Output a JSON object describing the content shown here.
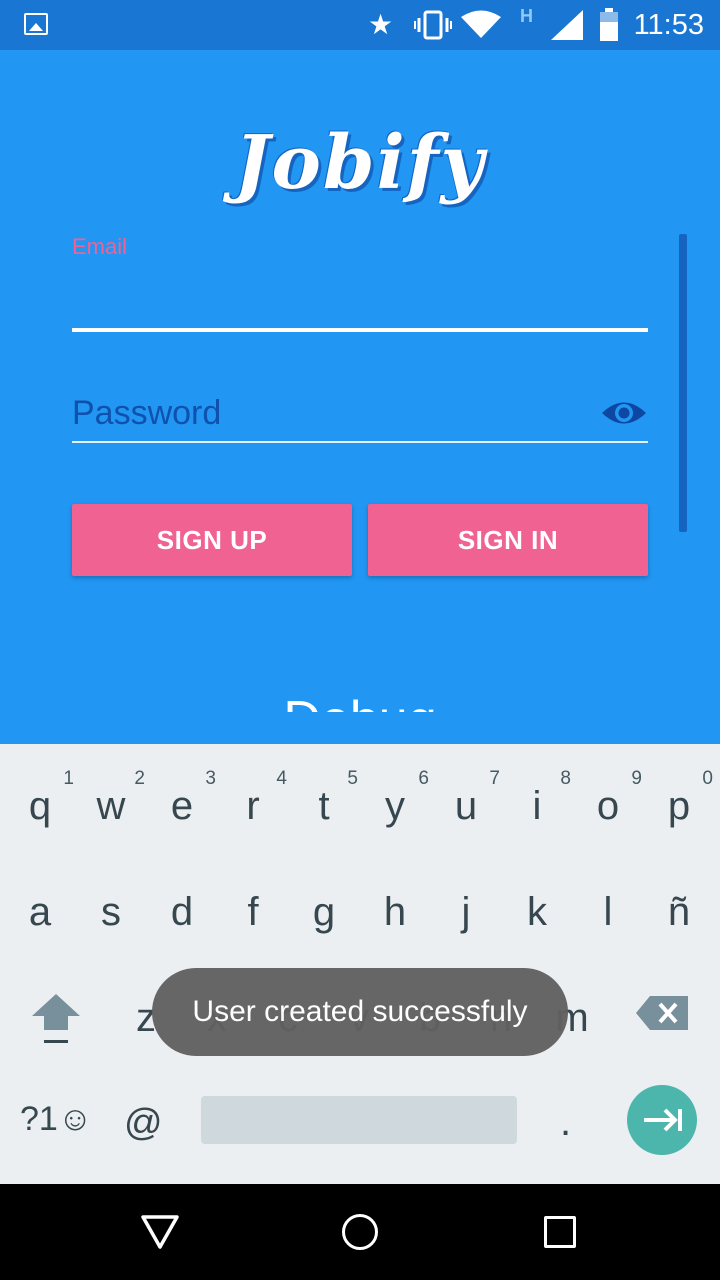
{
  "status_bar": {
    "time": "11:53",
    "network_type": "H"
  },
  "app": {
    "logo": "Jobify",
    "debug_label": "Debug"
  },
  "form": {
    "email_label": "Email",
    "email_value": "",
    "password_placeholder": "Password",
    "signup_label": "SIGN UP",
    "signin_label": "SIGN IN"
  },
  "keyboard": {
    "row1": [
      {
        "label": "q",
        "hint": "1"
      },
      {
        "label": "w",
        "hint": "2"
      },
      {
        "label": "e",
        "hint": "3"
      },
      {
        "label": "r",
        "hint": "4"
      },
      {
        "label": "t",
        "hint": "5"
      },
      {
        "label": "y",
        "hint": "6"
      },
      {
        "label": "u",
        "hint": "7"
      },
      {
        "label": "i",
        "hint": "8"
      },
      {
        "label": "o",
        "hint": "9"
      },
      {
        "label": "p",
        "hint": "0"
      }
    ],
    "row2": [
      "a",
      "s",
      "d",
      "f",
      "g",
      "h",
      "j",
      "k",
      "l",
      "ñ"
    ],
    "row3": [
      "z",
      "x",
      "c",
      "v",
      "b",
      "n",
      "m"
    ],
    "symbols_label": "?1☺",
    "at_label": "@",
    "period_label": "."
  },
  "toast": {
    "message": "User created successfuly"
  },
  "colors": {
    "primary": "#2196F3",
    "primary_dark": "#1976D2",
    "accent": "#F06292",
    "keyboard_bg": "#ECEFF1",
    "enter_key": "#4DB6AC"
  },
  "icons": {
    "status": [
      "gallery-icon",
      "star-icon",
      "vibrate-icon",
      "wifi-icon",
      "signal-icon",
      "battery-icon"
    ],
    "password_toggle": "eye-icon",
    "keyboard": [
      "shift-icon",
      "backspace-icon",
      "enter-icon"
    ],
    "navigation": [
      "back-icon",
      "home-icon",
      "recents-icon"
    ]
  }
}
